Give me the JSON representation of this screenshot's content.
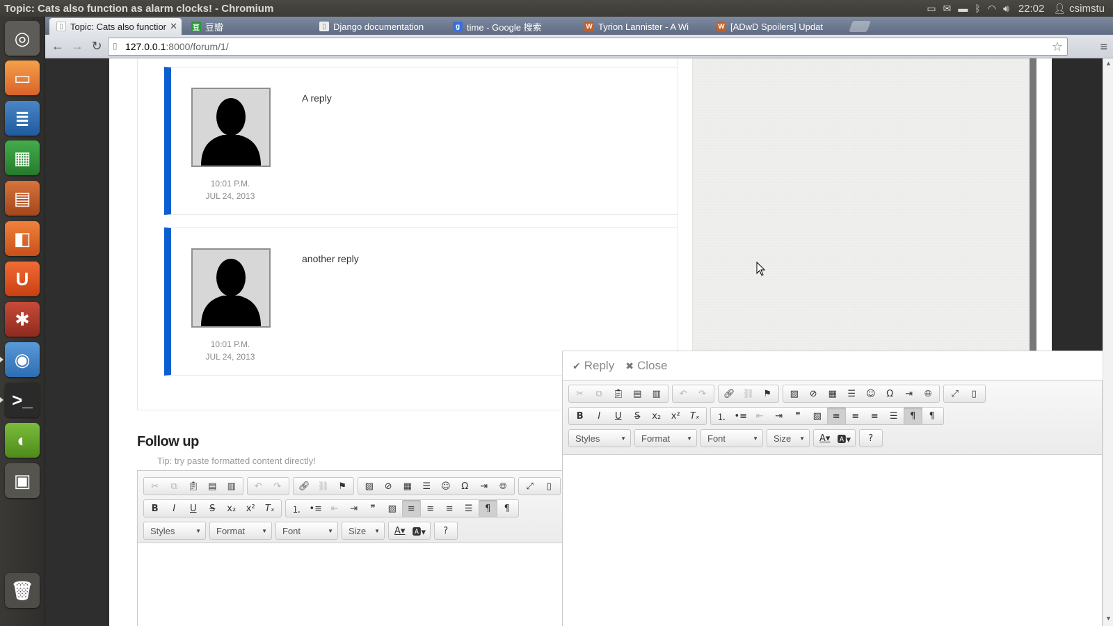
{
  "system_panel": {
    "window_title": "Topic: Cats also function as alarm clocks! - Chromium",
    "clock": "22:02",
    "user": "csimstu"
  },
  "browser": {
    "tabs": [
      {
        "label": "Topic: Cats also functior",
        "icon": "document-favicon",
        "active": true
      },
      {
        "label": "豆瓣",
        "icon": "douban-favicon"
      },
      {
        "label": "Django documentation",
        "icon": "document-favicon"
      },
      {
        "label": "time - Google 搜索",
        "icon": "google-favicon"
      },
      {
        "label": "Tyrion Lannister - A Wi",
        "icon": "wiki-favicon"
      },
      {
        "label": "[ADwD Spoilers] Updat",
        "icon": "wiki-favicon"
      }
    ],
    "url_host": "127.0.0.1",
    "url_path": ":8000/forum/1/"
  },
  "posts": [
    {
      "body": "A reply",
      "time": "10:01 P.M.",
      "date": "JUL 24, 2013"
    },
    {
      "body": "another reply",
      "time": "10:01 P.M.",
      "date": "JUL 24, 2013"
    }
  ],
  "followup": {
    "title": "Follow up",
    "tip": "Tip: try paste formatted content directly!"
  },
  "editor": {
    "combos": {
      "styles": "Styles",
      "format": "Format",
      "font": "Font",
      "size": "Size"
    },
    "help": "?"
  },
  "popup": {
    "reply_label": "Reply",
    "close_label": "Close"
  },
  "colors": {
    "post_accent": "#0b5fcf"
  }
}
